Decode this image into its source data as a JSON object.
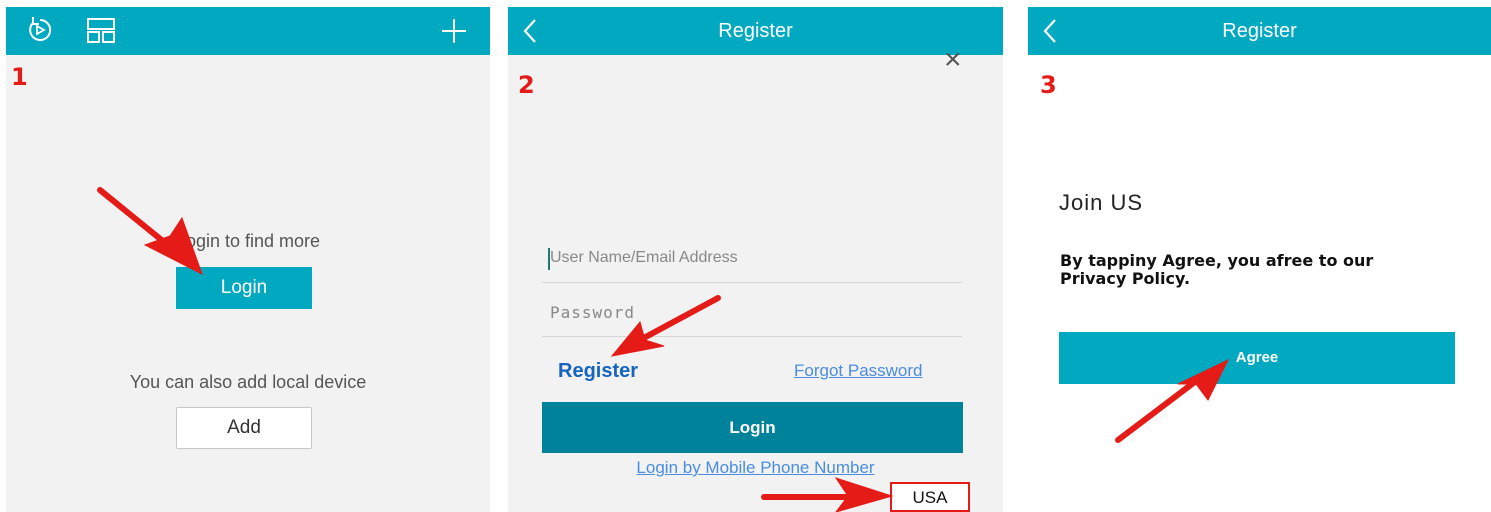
{
  "panel1": {
    "step": "1",
    "prompt": "Login to find more",
    "login_label": "Login",
    "local_text": "You can also add local device",
    "add_label": "Add"
  },
  "panel2": {
    "step": "2",
    "title": "Register",
    "close": "×",
    "username_placeholder": "User Name/Email Address",
    "password_placeholder": "Password",
    "register_label": "Register",
    "forgot_label": "Forgot Password",
    "login_label": "Login",
    "mobile_login_label": "Login by Mobile Phone Number",
    "region": "USA"
  },
  "panel3": {
    "step": "3",
    "title": "Register",
    "heading": "Join US",
    "policy_text": "By tappiny Agree, you afree to our Privacy Policy.",
    "agree_label": "Agree"
  },
  "colors": {
    "accent": "#00a9c0",
    "dark_button": "#00829a",
    "annotation_red": "#e41b17",
    "link": "#4a8de0",
    "register_blue": "#1565c0"
  }
}
